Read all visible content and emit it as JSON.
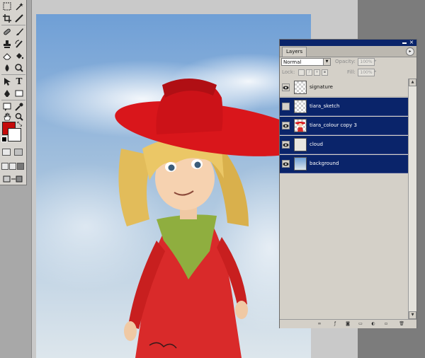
{
  "panel": {
    "tab_label": "Layers",
    "blend_mode": "Normal",
    "opacity_label": "Opacity:",
    "opacity_value": "100%",
    "lock_label": "Lock:",
    "fill_label": "Fill:",
    "fill_value": "100%"
  },
  "layers": [
    {
      "name": "signature",
      "visible": true,
      "selected": false
    },
    {
      "name": "tiara_sketch",
      "visible": false,
      "selected": true
    },
    {
      "name": "tiara_colour copy 3",
      "visible": true,
      "selected": true
    },
    {
      "name": "cloud",
      "visible": true,
      "selected": true
    },
    {
      "name": "background",
      "visible": true,
      "selected": true
    }
  ],
  "colors": {
    "foreground": "#c40a0a",
    "background": "#ffffff",
    "selection": "#0a246a"
  },
  "icons": {
    "toolbox": [
      "marquee-icon",
      "magic-wand-icon",
      "crop-icon",
      "slice-icon",
      "healing-brush-icon",
      "brush-icon",
      "clone-stamp-icon",
      "history-brush-icon",
      "eraser-icon",
      "paint-bucket-icon",
      "blur-icon",
      "dodge-icon",
      "path-selection-icon",
      "type-icon",
      "pen-icon",
      "rectangle-shape-icon",
      "notes-icon",
      "eyedropper-icon",
      "hand-icon",
      "zoom-icon"
    ],
    "footer": [
      "link-icon",
      "layer-style-icon",
      "layer-mask-icon",
      "new-group-icon",
      "adjustment-layer-icon",
      "new-layer-icon",
      "trash-icon"
    ]
  }
}
